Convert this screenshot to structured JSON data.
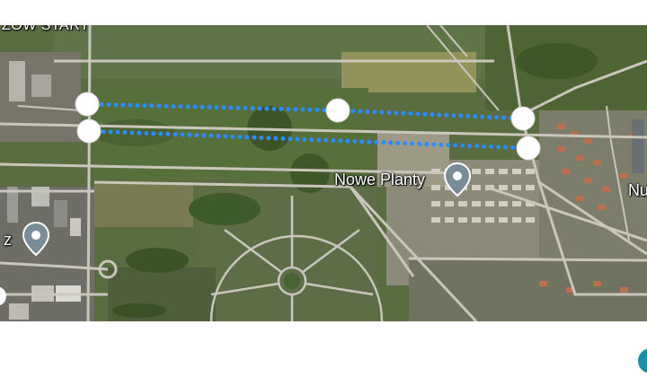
{
  "top_hint": "",
  "map": {
    "street_label": "ZOW START",
    "pois": [
      {
        "name": "Nowe Planty",
        "icon": "location-pin-icon"
      },
      {
        "name": "z",
        "icon": "location-pin-icon"
      },
      {
        "name": "Nu",
        "icon": ""
      }
    ],
    "route": {
      "color": "#2d8cff",
      "style": "dotted"
    },
    "waypoint_color": "#ffffff",
    "pin_color": "#7a8c97"
  }
}
